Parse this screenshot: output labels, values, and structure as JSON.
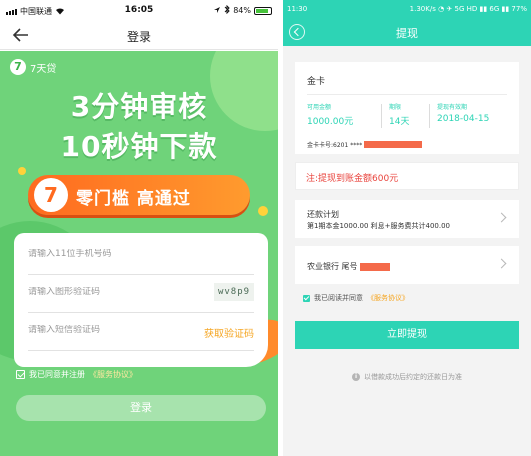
{
  "left": {
    "status": {
      "carrier": "中国联通",
      "time": "16:05",
      "battery": "84%",
      "battery_level": 0.84
    },
    "nav": {
      "title": "登录"
    },
    "brand": {
      "logo": "7",
      "name": "7天贷"
    },
    "headline": {
      "line1": "3分钟审核",
      "line2": "10秒钟下款"
    },
    "banner": {
      "badge": "7",
      "text": "零门槛  高通过"
    },
    "form": {
      "phone_placeholder": "请输入11位手机号码",
      "captcha_placeholder": "请输入图形验证码",
      "captcha_image_text": "wv8p9",
      "sms_placeholder": "请输入短信验证码",
      "get_code_label": "获取验证码"
    },
    "agreement": {
      "text": "我已同意并注册",
      "link": "《服务协议》"
    },
    "login_button": "登录",
    "colors": {
      "green": "#6fd37a",
      "orange": "#ff7a22",
      "button": "#a7e3ad"
    }
  },
  "right": {
    "status": {
      "time": "11:30",
      "indicators": "1.30K/s  ◔  ✈  5G  HD  ▮▮  6G  ▮▮  77%"
    },
    "nav": {
      "title": "提现"
    },
    "card": {
      "name": "金卡",
      "columns": [
        {
          "label": "可用金额",
          "value": "1000.00元"
        },
        {
          "label": "期限",
          "value": "14天"
        },
        {
          "label": "提现有效期",
          "value": "2018-04-15"
        }
      ],
      "card_no": "金卡卡号:6201 ****"
    },
    "notice": "注:提现到账金额600元",
    "repayment": {
      "title": "还款计划",
      "detail": "第1期本金1000.00  利息+服务费共计400.00"
    },
    "bank": {
      "label": "农业银行 尾号"
    },
    "agreement": {
      "text": "我已阅读并同意",
      "link": "《服务协议》"
    },
    "withdraw_button": "立即提现",
    "footer_note": "以借款成功后约定的还款日为准",
    "colors": {
      "teal": "#2dd4b5",
      "notice_red": "#e9433c",
      "redaction": "#f46a4a"
    }
  }
}
